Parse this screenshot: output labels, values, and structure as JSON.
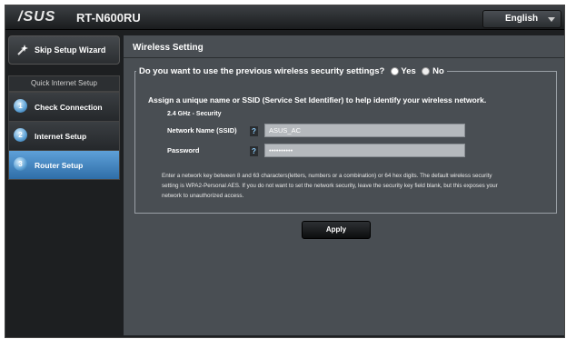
{
  "header": {
    "brand": "/SUS",
    "model": "RT-N600RU",
    "language": "English"
  },
  "sidebar": {
    "skip_label": "Skip Setup Wizard",
    "section_label": "Quick Internet Setup",
    "steps": [
      {
        "num": "1",
        "label": "Check Connection"
      },
      {
        "num": "2",
        "label": "Internet Setup"
      },
      {
        "num": "3",
        "label": "Router Setup"
      }
    ]
  },
  "main": {
    "title": "Wireless Setting",
    "question": "Do you want to use the previous wireless security settings?",
    "yes": "Yes",
    "no": "No",
    "assign_text": "Assign a unique name or SSID (Service Set Identifier) to help identify your wireless network.",
    "band_label": "2.4 GHz - Security",
    "ssid_label": "Network Name (SSID)",
    "ssid_value": "ASUS_AC",
    "password_label": "Password",
    "password_value": "••••••••••",
    "help_text": "Enter a network key between 8 and 63 characters(letters, numbers or a combination) or 64 hex digits. The default wireless security setting is WPA2-Personal AES. If you do not want to set the network security, leave the security key field blank, but this exposes your network to unauthorized access.",
    "apply_label": "Apply"
  },
  "colors": {
    "accent": "#3f86c6",
    "panel": "#494e53",
    "background": "#1d1f21"
  }
}
